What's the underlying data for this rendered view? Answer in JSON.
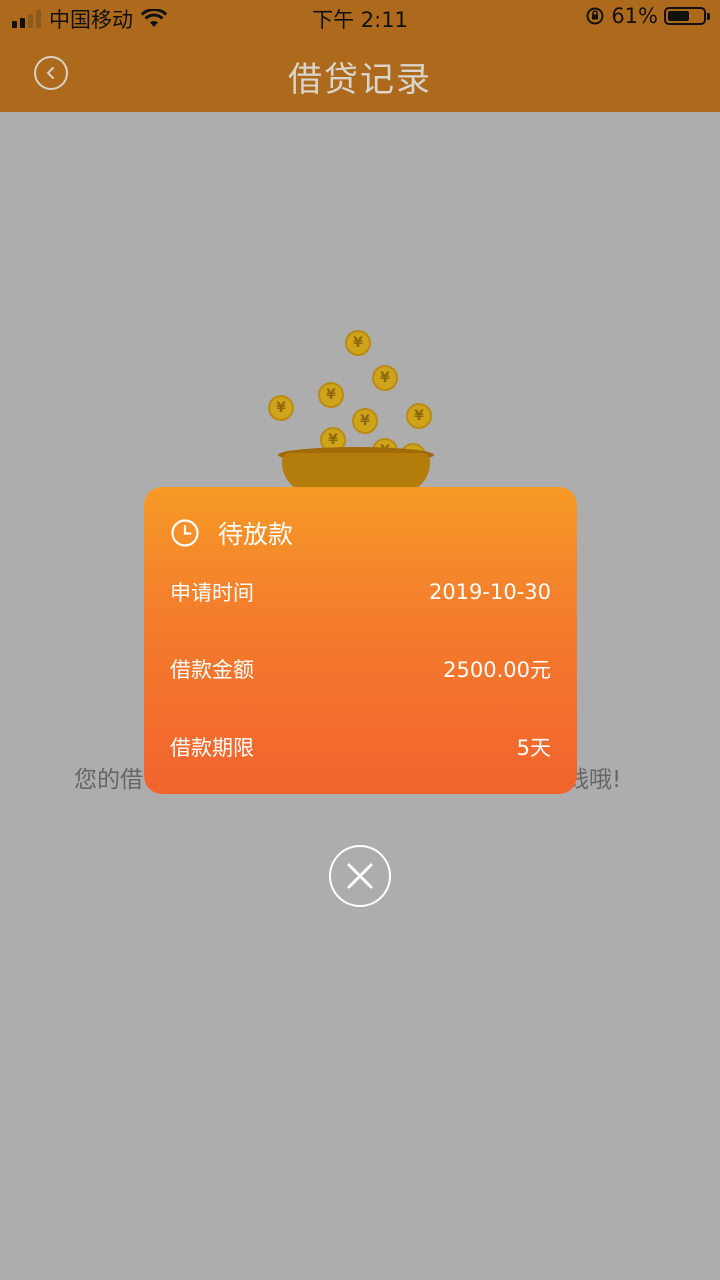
{
  "status_bar": {
    "carrier": "中国移动",
    "time": "下午 2:11",
    "battery": "61%",
    "battery_level": 0.61,
    "icons": [
      "signal-icon",
      "wifi-icon",
      "rotation-lock-icon",
      "battery-icon"
    ]
  },
  "nav": {
    "title": "借贷记录",
    "back_icon": "chevron-left-icon"
  },
  "background": {
    "message_left": "您的借",
    "message_right": "钱哦!",
    "illustration": "coins-pot-icon"
  },
  "modal": {
    "status_icon": "clock-icon",
    "status": "待放款",
    "rows": [
      {
        "label": "申请时间",
        "value": "2019-10-30"
      },
      {
        "label": "借款金额",
        "value": "2500.00元"
      },
      {
        "label": "借款期限",
        "value": "5天"
      }
    ],
    "close_icon": "close-icon"
  },
  "colors": {
    "nav_bg": "#ae6a1c",
    "overlay_bg": "#adadad",
    "modal_top": "#f69a27",
    "modal_bottom": "#f2632e"
  }
}
